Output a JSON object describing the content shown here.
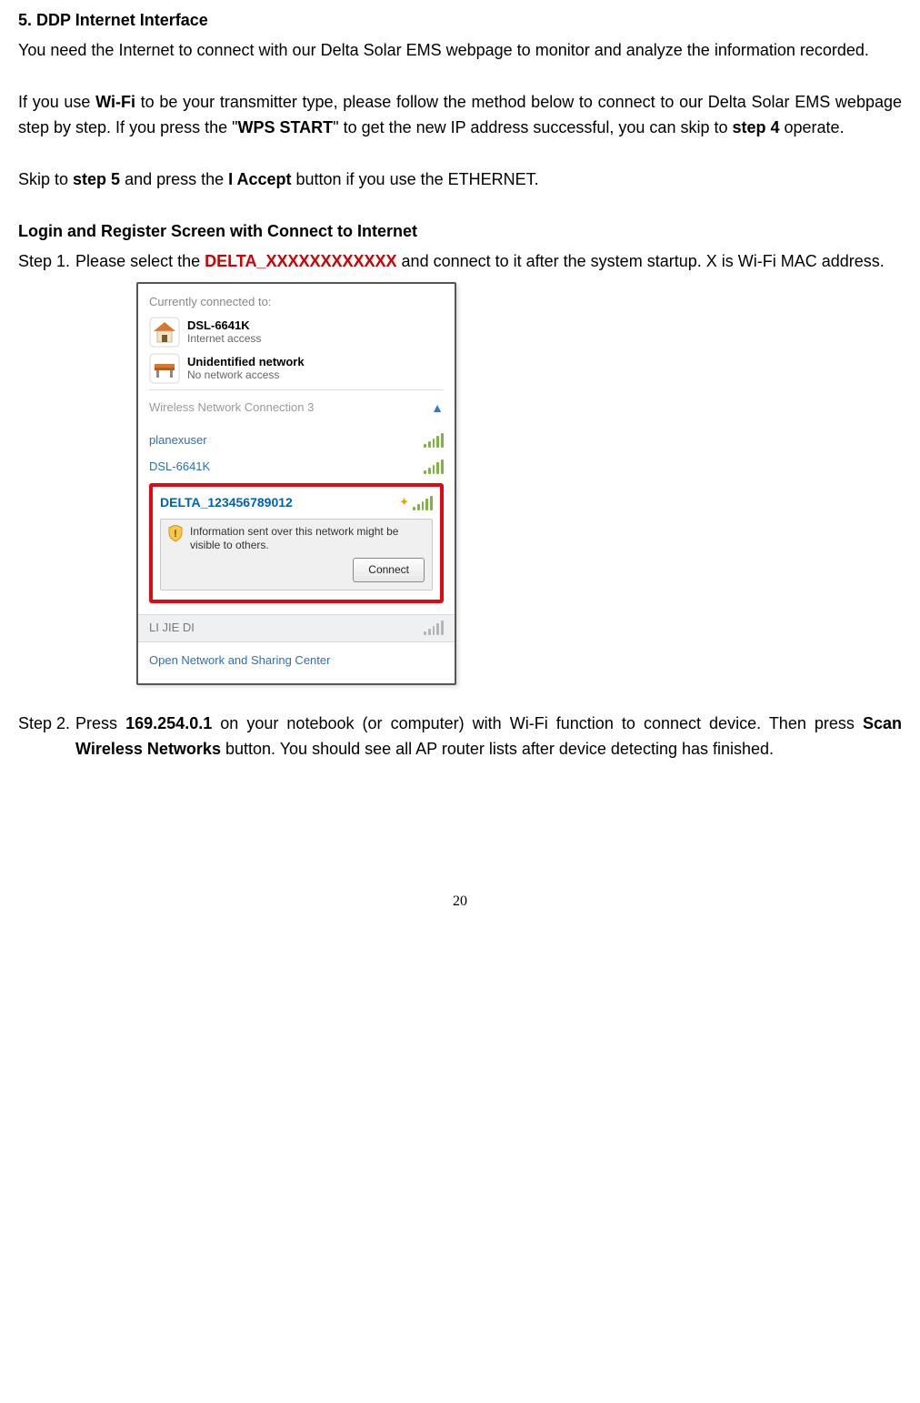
{
  "heading": "5.  DDP Internet Interface",
  "intro": "You need the Internet to connect with our Delta Solar EMS webpage to monitor and analyze the information recorded.",
  "wifi_para_pre": "If you use ",
  "wifi_bold": "Wi-Fi",
  "wifi_para_mid": " to be your transmitter type, please follow the method below to connect to our Delta Solar EMS webpage step by step. If you press the \"",
  "wps_bold": "WPS START",
  "wifi_para_mid2": "\" to get the new IP address successful, you can skip to ",
  "step4_bold": "step 4",
  "wifi_para_end": " operate.",
  "skip_pre": "Skip to ",
  "step5_bold": "step 5",
  "skip_mid": " and press the ",
  "iaccept_bold": "I Accept",
  "skip_end": " button if you use the ETHERNET.",
  "login_heading": "Login and Register Screen with Connect to Internet",
  "step1_label": "Step 1.",
  "step1_pre": "Please select the ",
  "step1_red": "DELTA_XXXXXXXXXXXX",
  "step1_post": " and connect to it after the system startup. X is Wi-Fi MAC address.",
  "step2_label": "Step 2.",
  "step2_pre": "Press ",
  "step2_ip": "169.254.0.1",
  "step2_mid": " on your notebook (or computer) with Wi-Fi function to connect device. Then press ",
  "step2_scan": "Scan Wireless Networks",
  "step2_end": " button. You should see all AP router lists after device detecting has finished.",
  "pagenum": "20",
  "shot": {
    "cc_title": "Currently connected to:",
    "net1_name": "DSL-6641K",
    "net1_sub": "Internet access",
    "net2_name": "Unidentified network",
    "net2_sub": "No network access",
    "wsec": "Wireless Network Connection 3",
    "ap1": "planexuser",
    "ap2": "DSL-6641K",
    "delta": "DELTA_123456789012",
    "info_text": "Information sent over this network might be visible to others.",
    "connect": "Connect",
    "ap3": "LI JIE DI",
    "footer": "Open Network and Sharing Center"
  }
}
